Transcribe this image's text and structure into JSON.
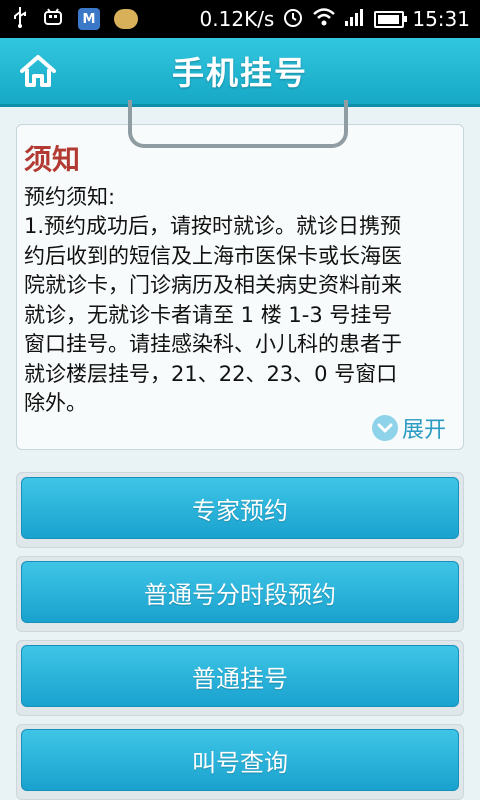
{
  "status_bar": {
    "speed": "0.12K/s",
    "time": "15:31"
  },
  "header": {
    "title": "手机挂号"
  },
  "notice": {
    "title": "须知",
    "subtitle": "预约须知:",
    "lines": [
      "1.预约成功后，请按时就诊。就诊日携预",
      "约后收到的短信及上海市医保卡或长海医",
      "院就诊卡，门诊病历及相关病史资料前来",
      "就诊，无就诊卡者请至 1 楼 1-3 号挂号",
      "窗口挂号。请挂感染科、小儿科的患者于",
      "就诊楼层挂号，21、22、23、0 号窗口",
      "除外。"
    ],
    "expand_label": "展开"
  },
  "buttons": {
    "expert": "专家预约",
    "timeslot": "普通号分时段预约",
    "regular": "普通挂号",
    "queue": "叫号查询"
  }
}
